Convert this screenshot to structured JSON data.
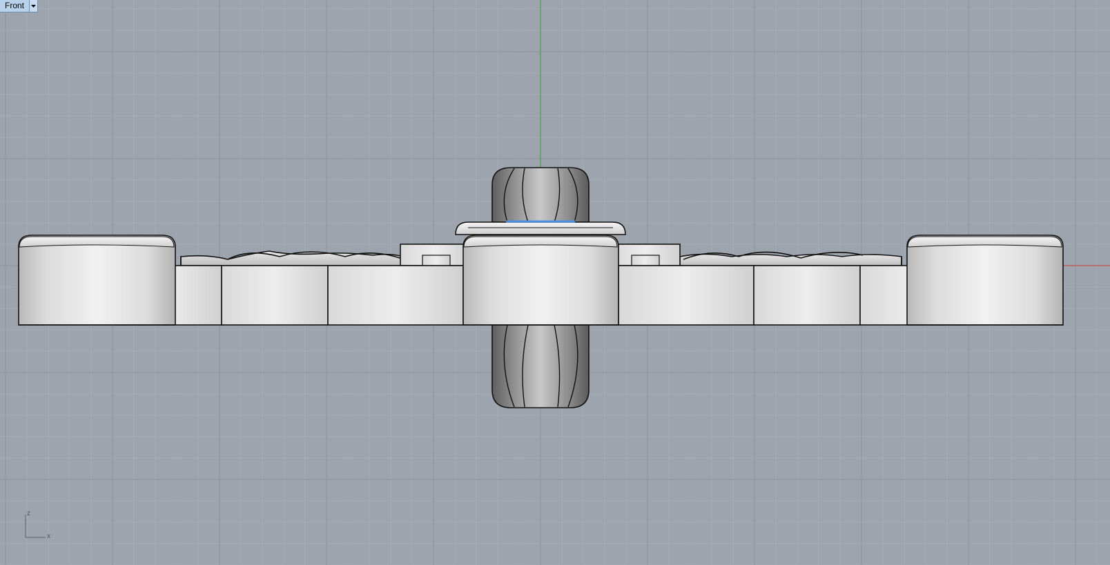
{
  "viewport": {
    "name": "Front",
    "menu_icon": "triangle-down-icon"
  },
  "axes": {
    "vertical_label": "z",
    "horizontal_label": "x",
    "vertical_color": "#3fa83f",
    "horizontal_color": "#c0504d"
  },
  "colors": {
    "background": "#9ea4ad",
    "grid_minor": "#a8aeb6",
    "grid_major": "#8c939c",
    "highlight": "#4a90e2"
  }
}
